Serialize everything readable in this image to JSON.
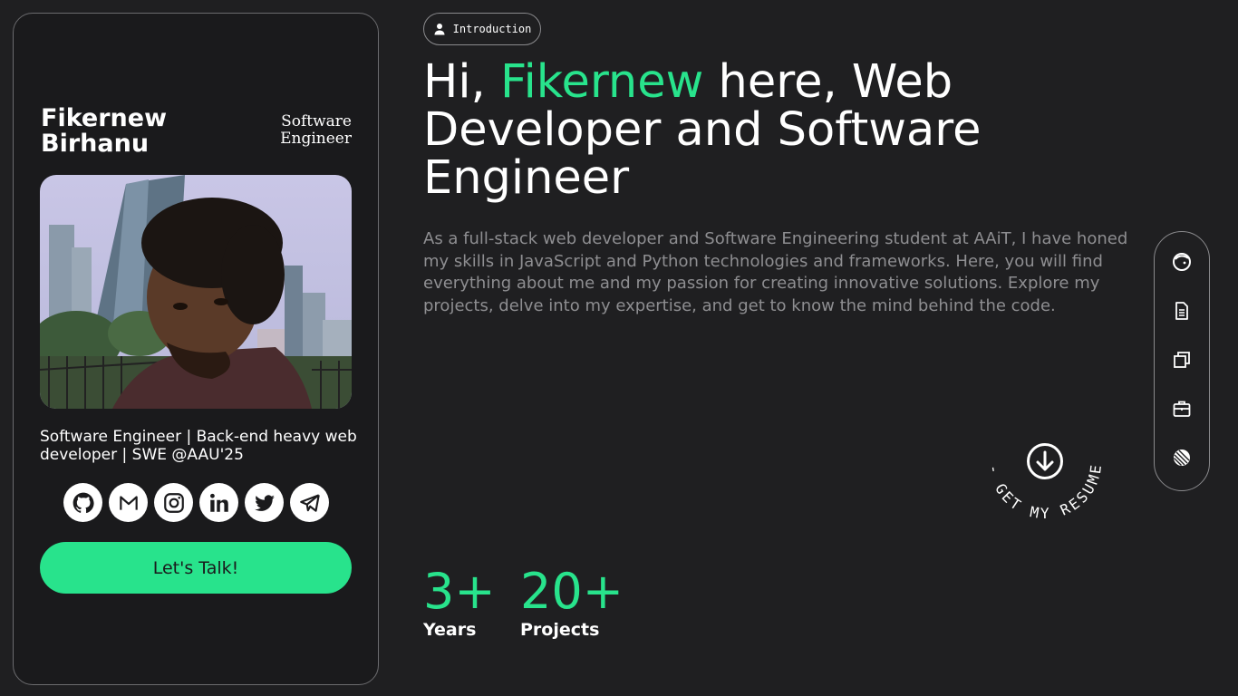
{
  "profile": {
    "name": "Fikernew Birhanu",
    "role": "Software Engineer",
    "bio": "Software Engineer | Back-end heavy web developer | SWE @AAU'25",
    "cta_label": "Let's Talk!",
    "socials": [
      {
        "icon": "github-icon"
      },
      {
        "icon": "gmail-icon"
      },
      {
        "icon": "instagram-icon"
      },
      {
        "icon": "linkedin-icon"
      },
      {
        "icon": "twitter-icon"
      },
      {
        "icon": "telegram-icon"
      }
    ]
  },
  "intro": {
    "pill_label": "Introduction",
    "headline_prefix": "Hi, ",
    "headline_name": "Fikernew",
    "headline_suffix": " here, Web Developer and Software Engineer",
    "description": "As a full-stack web developer and Software Engineering student at AAiT, I have honed my skills in JavaScript and Python technologies and frameworks. Here, you will find everything about me and my passion for creating innovative solutions. Explore my projects, delve into my expertise, and get to know the mind behind the code."
  },
  "resume": {
    "label": "- GET MY RESUME -"
  },
  "stats": [
    {
      "value": "3+",
      "label": "Years"
    },
    {
      "value": "20+",
      "label": "Projects"
    }
  ],
  "side_nav": [
    {
      "icon": "face-icon"
    },
    {
      "icon": "document-icon"
    },
    {
      "icon": "copy-icon"
    },
    {
      "icon": "briefcase-icon"
    },
    {
      "icon": "globe-icon"
    }
  ],
  "colors": {
    "background": "#1f1f21",
    "accent": "#28e38c",
    "muted_text": "#8e8e91",
    "border": "#6b6b6e"
  }
}
